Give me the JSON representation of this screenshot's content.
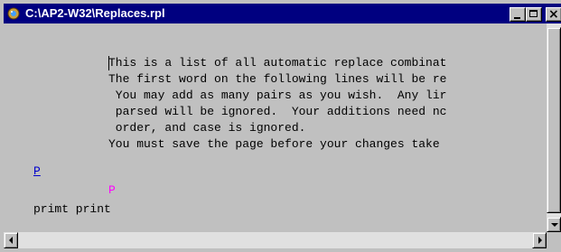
{
  "window": {
    "title": "C:\\AP2-W32\\Replaces.rpl",
    "icon": "app-icon",
    "controls": {
      "minimize": "minimize-icon",
      "maximize": "maximize-icon",
      "close": "×"
    }
  },
  "content": {
    "lines": [
      "This is a list of all automatic replace combinat",
      "The first word on the following lines will be re",
      " You may add as many pairs as you wish.  Any lir",
      " parsed will be ignored.  Your additions need nc",
      " order, and case is ignored.",
      "You must save the page before your changes take"
    ],
    "link_label": "P",
    "marker_label": "P",
    "replace_pair": "primt print"
  },
  "colors": {
    "titlebar": "#000080",
    "window_bg": "#c0c0c0",
    "link": "#0000cc",
    "marker": "#ff00ff"
  }
}
